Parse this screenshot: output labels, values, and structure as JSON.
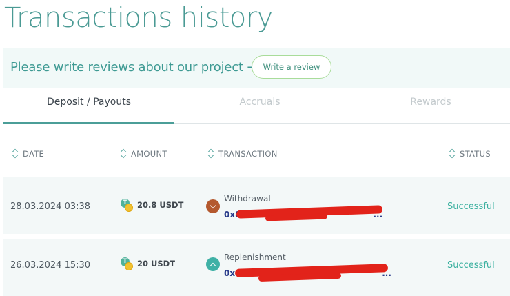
{
  "page": {
    "title": "Transactions history"
  },
  "banner": {
    "text": "Please write reviews about our project →",
    "button_label": "Write a review"
  },
  "tabs": [
    {
      "label": "Deposit / Payouts",
      "active": true
    },
    {
      "label": "Accruals",
      "active": false
    },
    {
      "label": "Rewards",
      "active": false
    }
  ],
  "table": {
    "headers": {
      "date": "DATE",
      "amount": "AMOUNT",
      "transaction": "TRANSACTION",
      "status": "STATUS"
    },
    "rows": [
      {
        "date": "28.03.2024 03:38",
        "amount": "20.8 USDT",
        "type": "Withdrawal",
        "direction": "down",
        "hash_visible": "0x8",
        "hash_tail": "...",
        "status": "Successful"
      },
      {
        "date": "26.03.2024 15:30",
        "amount": "20 USDT",
        "type": "Replenishment",
        "direction": "up",
        "hash_visible": "0xe",
        "hash_tail": "...",
        "status": "Successful"
      }
    ]
  },
  "colors": {
    "accent": "#4a9a94",
    "status_success": "#3ab09f",
    "withdrawal_icon": "#b4592f",
    "replenishment_icon": "#3fb1a6",
    "redaction": "#e2231a"
  }
}
